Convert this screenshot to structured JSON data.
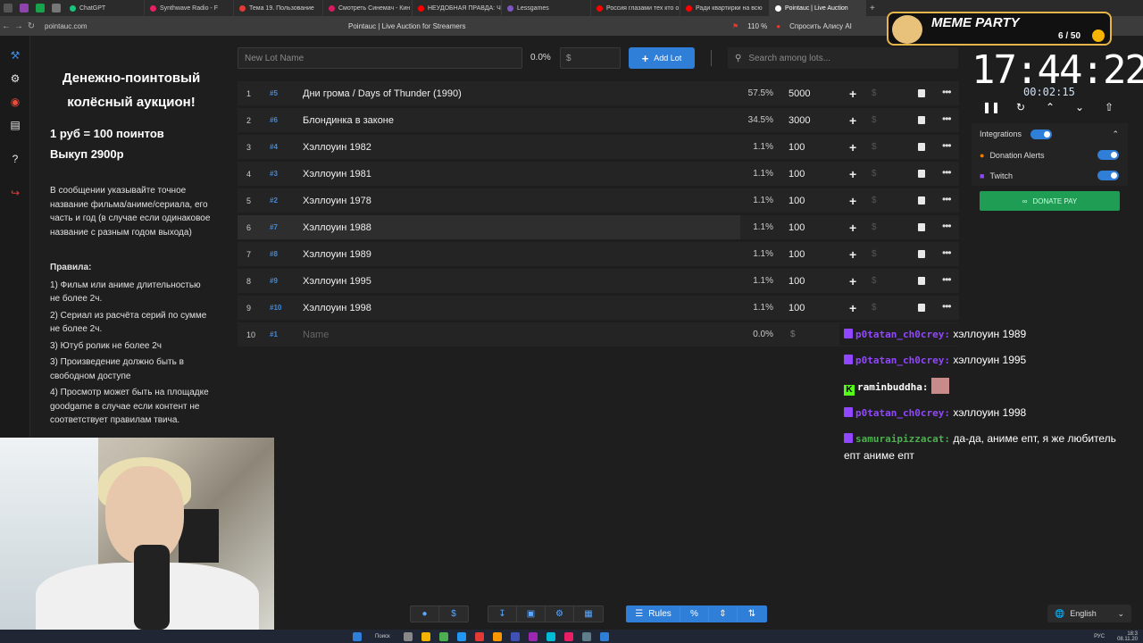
{
  "browser": {
    "tabs": [
      {
        "label": "ChatGPT",
        "color": "#19c37d"
      },
      {
        "label": "Synthwave Radio - F",
        "color": "#e91e63"
      },
      {
        "label": "Тема 19. Пользование",
        "color": "#e53935"
      },
      {
        "label": "Смотреть Синемач - Кин",
        "color": "#d81b60"
      },
      {
        "label": "НЕУДОБНАЯ ПРАВДА: Ч",
        "color": "#ff0000"
      },
      {
        "label": "Lessgames",
        "color": "#7e57c2"
      },
      {
        "label": "Россия глазами тех кто о",
        "color": "#ff0000"
      },
      {
        "label": "Ради квартирки на всю",
        "color": "#ff0000"
      },
      {
        "label": "Pointauc | Live Auction",
        "color": "#ffffff",
        "active": true
      }
    ],
    "url": "pointauc.com",
    "page_title": "Pointauc | Live Auction for Streamers",
    "zoom": "110 %",
    "ask_alice": "Спросить Алису AI"
  },
  "rules": {
    "title": "Денежно-поинтовый колёсный аукцион!",
    "rate": "1 руб = 100 поинтов",
    "buyout": "Выкуп 2900р",
    "message_note": "В сообщении указывайте точное название фильма/аниме/сериала, его часть и год (в случае если одинаковое название с разным годом выхода)",
    "rules_title": "Правила:",
    "items": [
      "1) Фильм или аниме длительностью не более 2ч.",
      "2) Сериал из расчёта серий по сумме не более 2ч.",
      "3) Ютуб ролик не более 2ч",
      "3) Произведение должно быть в свободном доступе",
      "4) Просмотр может быть на площадке goodgame в случае если контент не соответствует правилам твича."
    ]
  },
  "controls": {
    "new_lot_placeholder": "New Lot Name",
    "percent": "0.0%",
    "amount_placeholder": "$",
    "add_lot": "Add Lot",
    "search_placeholder": "Search among lots..."
  },
  "lots": [
    {
      "index": "1",
      "fast_id": "#5",
      "name": "Дни грома / Days of Thunder (1990)",
      "percent": "57.5%",
      "amount": "5000"
    },
    {
      "index": "2",
      "fast_id": "#6",
      "name": "Блондинка в законе",
      "percent": "34.5%",
      "amount": "3000"
    },
    {
      "index": "3",
      "fast_id": "#4",
      "name": "Хэллоуин 1982",
      "percent": "1.1%",
      "amount": "100"
    },
    {
      "index": "4",
      "fast_id": "#3",
      "name": "Хэллоуин 1981",
      "percent": "1.1%",
      "amount": "100"
    },
    {
      "index": "5",
      "fast_id": "#2",
      "name": "Хэллоуин 1978",
      "percent": "1.1%",
      "amount": "100"
    },
    {
      "index": "6",
      "fast_id": "#7",
      "name": "Хэллоуин 1988",
      "percent": "1.1%",
      "amount": "100"
    },
    {
      "index": "7",
      "fast_id": "#8",
      "name": "Хэллоуин 1989",
      "percent": "1.1%",
      "amount": "100"
    },
    {
      "index": "8",
      "fast_id": "#9",
      "name": "Хэллоуин 1995",
      "percent": "1.1%",
      "amount": "100"
    },
    {
      "index": "9",
      "fast_id": "#10",
      "name": "Хэллоуин 1998",
      "percent": "1.1%",
      "amount": "100"
    }
  ],
  "empty_lot": {
    "index": "10",
    "fast_id": "#1",
    "name_placeholder": "Name",
    "percent": "0.0%",
    "amount_placeholder": "$"
  },
  "timer": {
    "main": "17:44:22",
    "elapsed": "00:02:15"
  },
  "integrations": {
    "title": "Integrations",
    "items": [
      {
        "label": "Donation Alerts",
        "enabled": true
      },
      {
        "label": "Twitch",
        "enabled": true
      }
    ],
    "donate_pay": "DONATE PAY"
  },
  "chat": [
    {
      "platform": "twitch",
      "user": "p0tatan_ch0crey:",
      "text": "хэллоуин 1989",
      "color": "#9146ff"
    },
    {
      "platform": "twitch",
      "user": "p0tatan_ch0crey:",
      "text": "хэллоуин 1995",
      "color": "#9146ff"
    },
    {
      "platform": "kick",
      "user": "raminbuddha:",
      "text": "",
      "color": "#ffffff"
    },
    {
      "platform": "twitch",
      "user": "p0tatan_ch0crey:",
      "text": "хэллоуин 1998",
      "color": "#9146ff"
    },
    {
      "platform": "twitch",
      "user": "samuraipizzacat:",
      "text": "да-да, аниме епт, я же любитель епт аниме епт",
      "color": "#4caf50"
    }
  ],
  "meme_party": {
    "title": "MEME PARTY",
    "count": "6 / 50"
  },
  "bottom_toolbar": {
    "rules_label": "Rules"
  },
  "language": "English",
  "taskbar": {
    "search": "Поиск",
    "lang": "РУС",
    "time": "18:3",
    "date": "08.11.20"
  },
  "colors": {
    "accent": "#2f7fd9",
    "fast_id": "#3d8be0",
    "donate": "#1f9d55"
  }
}
